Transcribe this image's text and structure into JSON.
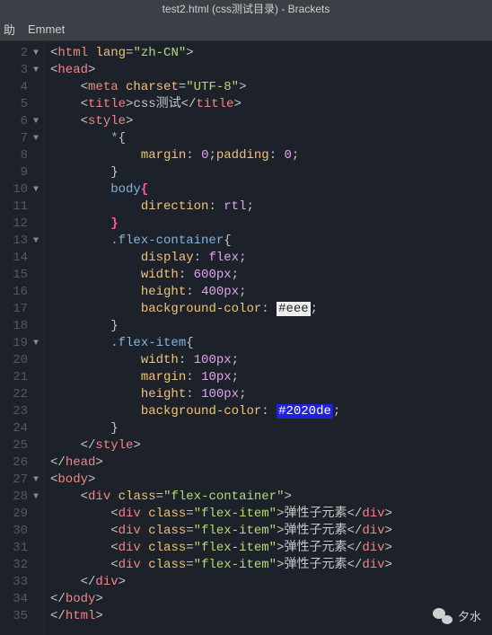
{
  "window": {
    "title": "test2.html (css测试目录) - Brackets"
  },
  "menu": {
    "item1": "助",
    "item2": "Emmet"
  },
  "gutter": {
    "lines": [
      "2",
      "3",
      "4",
      "5",
      "6",
      "7",
      "8",
      "9",
      "10",
      "11",
      "12",
      "13",
      "14",
      "15",
      "16",
      "17",
      "18",
      "19",
      "20",
      "21",
      "22",
      "23",
      "24",
      "25",
      "26",
      "27",
      "28",
      "29",
      "30",
      "31",
      "32",
      "33",
      "34",
      "35"
    ],
    "folds": {
      "2": true,
      "3": true,
      "6": true,
      "7": true,
      "10": true,
      "13": true,
      "19": true,
      "27": true,
      "28": true
    }
  },
  "code": {
    "html_open": {
      "tag": "html",
      "attr": "lang",
      "val": "\"zh-CN\""
    },
    "head_open": {
      "tag": "head"
    },
    "meta": {
      "tag": "meta",
      "attr": "charset",
      "val": "\"UTF-8\""
    },
    "title": {
      "tag": "title",
      "text": "css测试"
    },
    "style_open": {
      "tag": "style"
    },
    "rule_star": {
      "sel": "*",
      "decls": [
        {
          "p": "margin",
          "v": "0"
        },
        {
          "p": "padding",
          "v": "0"
        }
      ]
    },
    "rule_body": {
      "sel": "body",
      "decls": [
        {
          "p": "direction",
          "v": "rtl"
        }
      ]
    },
    "rule_container": {
      "sel": ".flex-container",
      "decls": [
        {
          "p": "display",
          "v": "flex"
        },
        {
          "p": "width",
          "v": "600px"
        },
        {
          "p": "height",
          "v": "400px"
        },
        {
          "p": "background-color",
          "v": "#eee"
        }
      ]
    },
    "rule_item": {
      "sel": ".flex-item",
      "decls": [
        {
          "p": "width",
          "v": "100px"
        },
        {
          "p": "margin",
          "v": "10px"
        },
        {
          "p": "height",
          "v": "100px"
        },
        {
          "p": "background-color",
          "v": "#2020de"
        }
      ]
    },
    "style_close": "style",
    "head_close": "head",
    "body_open": {
      "tag": "body"
    },
    "div_container": {
      "tag": "div",
      "attr": "class",
      "val": "\"flex-container\""
    },
    "div_item": {
      "tag": "div",
      "attr": "class",
      "val": "\"flex-item\"",
      "text": "弹性子元素"
    },
    "div_close": "div",
    "body_close": "body",
    "html_close": "html"
  },
  "watermark": {
    "label": "夕水"
  }
}
